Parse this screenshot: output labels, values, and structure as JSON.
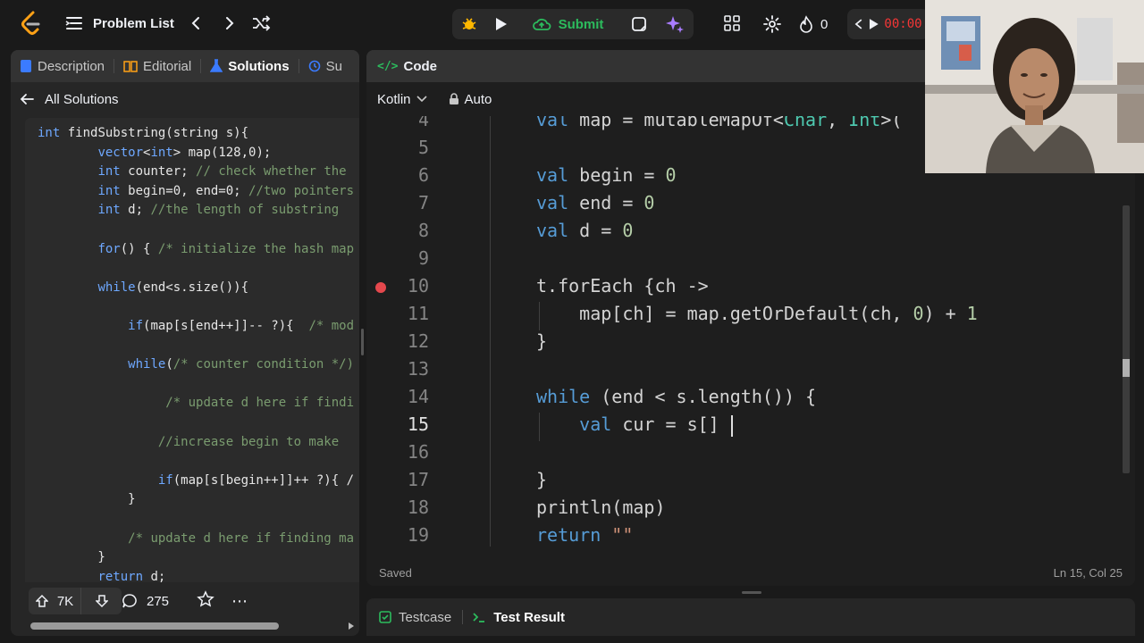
{
  "topbar": {
    "problem_list_label": "Problem List",
    "submit_label": "Submit",
    "streak_count": "0",
    "timer_text": "00:00:",
    "accent_color": "#2cbb5d"
  },
  "left_tabs": [
    {
      "label": "Description",
      "icon": "description-icon"
    },
    {
      "label": "Editorial",
      "icon": "book-icon"
    },
    {
      "label": "Solutions",
      "icon": "flask-icon"
    },
    {
      "label": "Su",
      "icon": "submissions-icon"
    }
  ],
  "all_solutions_label": "All Solutions",
  "solution_code": [
    "int findSubstring(string s){",
    "        vector<int> map(128,0);",
    "        int counter; // check whether the",
    "        int begin=0, end=0; //two pointers",
    "        int d; //the length of substring",
    "",
    "        for() { /* initialize the hash map",
    "",
    "        while(end<s.size()){",
    "",
    "            if(map[s[end++]]-- ?){  /* mod",
    "",
    "            while(/* counter condition */)",
    "",
    "                 /* update d here if findi",
    "",
    "                //increase begin to make",
    "",
    "                if(map[s[begin++]]++ ?){ /",
    "            }",
    "",
    "            /* update d here if finding ma",
    "        }",
    "        return d;"
  ],
  "left_footer": {
    "upvotes": "7K",
    "comments": "275"
  },
  "code_panel": {
    "title": "Code",
    "language": "Kotlin",
    "mode": "Auto",
    "status_left": "Saved",
    "status_right": "Ln 15, Col 25",
    "line_numbers": [
      "4",
      "5",
      "6",
      "7",
      "8",
      "9",
      "10",
      "11",
      "12",
      "13",
      "14",
      "15",
      "16",
      "17",
      "18",
      "19"
    ],
    "lines": [
      "val map = mutableMapOf<Char, Int>(",
      "",
      "val begin = 0",
      "val end = 0",
      "val d = 0",
      "",
      "t.forEach {ch ->",
      "    map[ch] = map.getOrDefault(ch, 0) + 1",
      "}",
      "",
      "while (end < s.length()) {",
      "    val cur = s[]",
      "",
      "}",
      "println(map)",
      "return \"\""
    ]
  },
  "bottom_tabs": [
    {
      "label": "Testcase"
    },
    {
      "label": "Test Result"
    }
  ]
}
